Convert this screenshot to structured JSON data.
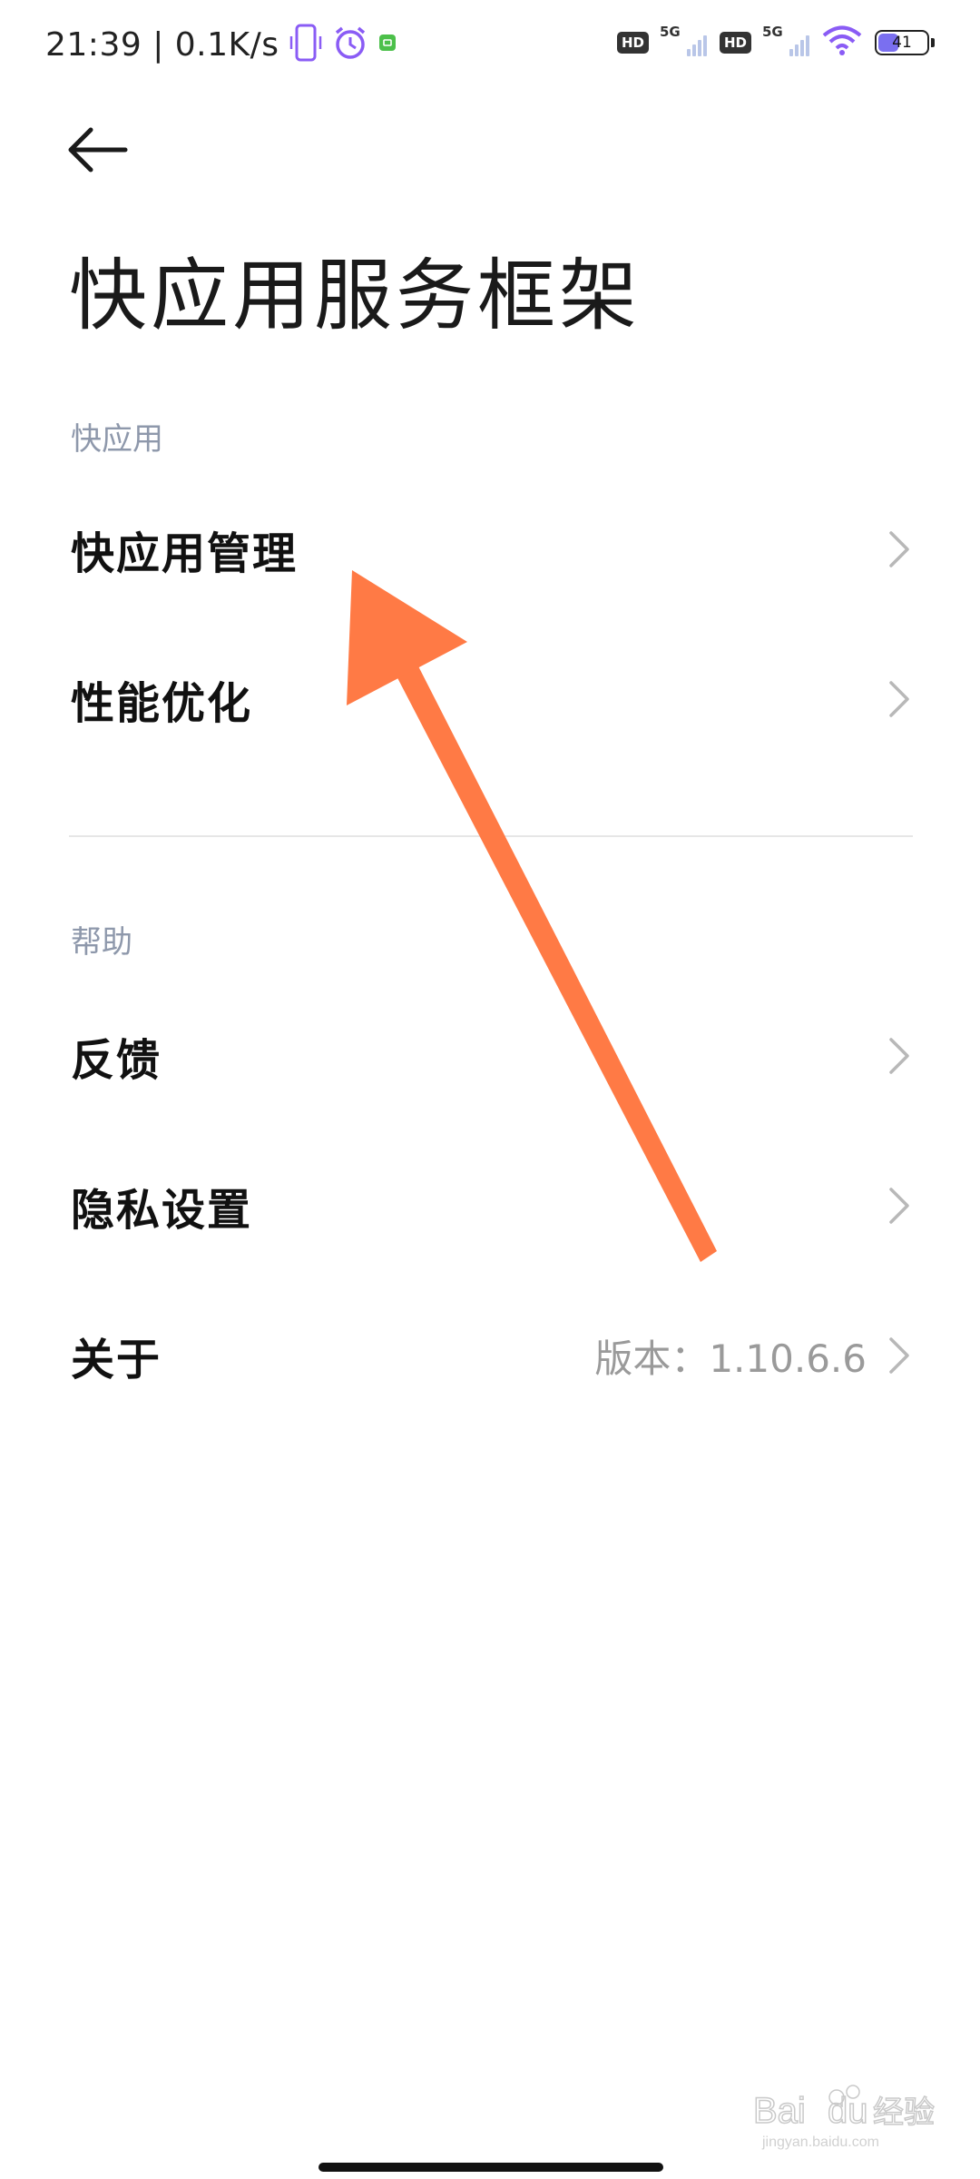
{
  "status_bar": {
    "time_speed": "21:39 | 0.1K/s",
    "hd1": "HD",
    "sig1": "5G",
    "hd2": "HD",
    "sig2": "5G",
    "battery": "41"
  },
  "header": {
    "back_icon": "back-arrow-icon",
    "title": "快应用服务框架"
  },
  "sections": [
    {
      "label": "快应用",
      "items": [
        {
          "label": "快应用管理"
        },
        {
          "label": "性能优化"
        }
      ]
    },
    {
      "label": "帮助",
      "items": [
        {
          "label": "反馈"
        },
        {
          "label": "隐私设置"
        },
        {
          "label": "关于",
          "value": "版本：1.10.6.6"
        }
      ]
    }
  ],
  "colors": {
    "accent_arrow": "#FF7A45",
    "section_label": "#8E98AB",
    "value_text": "#9A9A9A"
  },
  "watermark": {
    "logo_text": "Bai du 经验",
    "url": "jingyan.baidu.com"
  }
}
